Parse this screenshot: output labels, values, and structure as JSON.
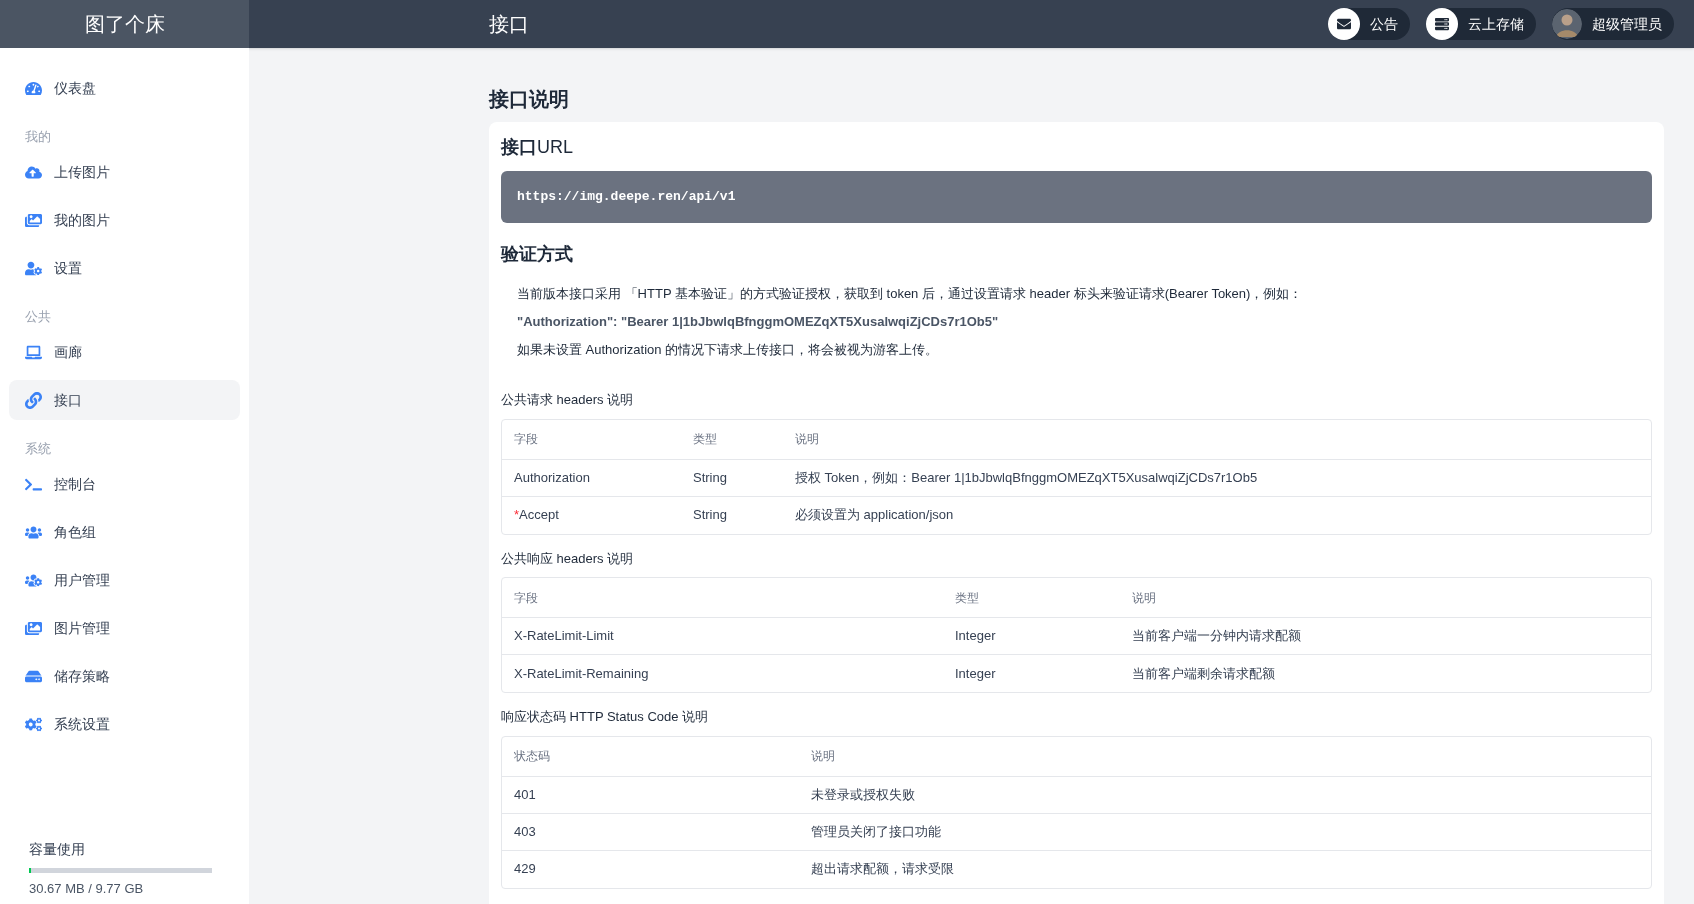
{
  "brand": "图了个床",
  "page_title": "接口",
  "top_actions": [
    {
      "kind": "icon",
      "label": "公告"
    },
    {
      "kind": "icon",
      "label": "云上存储"
    },
    {
      "kind": "avatar",
      "label": "超级管理员"
    }
  ],
  "sidebar": {
    "items": [
      {
        "kind": "item",
        "label": "仪表盘",
        "selected": false
      },
      {
        "kind": "heading",
        "label": "我的"
      },
      {
        "kind": "item",
        "label": "上传图片",
        "selected": false
      },
      {
        "kind": "item",
        "label": "我的图片",
        "selected": false
      },
      {
        "kind": "item",
        "label": "设置",
        "selected": false
      },
      {
        "kind": "heading",
        "label": "公共"
      },
      {
        "kind": "item",
        "label": "画廊",
        "selected": false
      },
      {
        "kind": "item",
        "label": "接口",
        "selected": true
      },
      {
        "kind": "heading",
        "label": "系统"
      },
      {
        "kind": "item",
        "label": "控制台",
        "selected": false
      },
      {
        "kind": "item",
        "label": "角色组",
        "selected": false
      },
      {
        "kind": "item",
        "label": "用户管理",
        "selected": false
      },
      {
        "kind": "item",
        "label": "图片管理",
        "selected": false
      },
      {
        "kind": "item",
        "label": "储存策略",
        "selected": false
      },
      {
        "kind": "item",
        "label": "系统设置",
        "selected": false
      }
    ],
    "storage": {
      "title": "容量使用",
      "level": 0.004,
      "reading": "30.67 MB / 9.77 GB"
    }
  },
  "main": {
    "title": "接口说明",
    "url_heading": "**接口**URL",
    "url": "https://img.deepe.ren/api/v1",
    "auth_heading": "验证方式",
    "auth_lines": [
      {
        "kind": "text",
        "text": "当前版本接口采用 「HTTP 基本验证」的方式验证授权，获取到 token 后，通过设置请求 header 标头来验证请求(Bearer Token)，例如："
      },
      {
        "kind": "code",
        "text": "\"Authorization\": \"Bearer 1|1bJbwlqBfnggmOMEZqXT5XusalwqiZjCDs7r1Ob5\""
      },
      {
        "kind": "text",
        "text": "如果未设置 Authorization 的情况下请求上传接口，将会被视为游客上传。"
      }
    ],
    "tables": [
      {
        "title": "公共请求 headers 说明",
        "kind": "narrow",
        "columns": [
          "字段",
          "类型",
          "说明"
        ],
        "rows": [
          {
            "cells": [
              "Authorization",
              "String",
              "授权 Token，例如：Bearer 1|1bJbwlqBfnggmOMEZqXT5XusalwqiZjCDs7r1Ob5"
            ]
          },
          {
            "required_mark": "*",
            "cells": [
              "Accept",
              "String",
              "必须设置为 application/json"
            ]
          }
        ]
      },
      {
        "title": "公共响应 headers 说明",
        "kind": "wide",
        "columns": [
          "字段",
          "类型",
          "说明"
        ],
        "rows": [
          {
            "cells": [
              "X-RateLimit-Limit",
              "Integer",
              "当前客户端一分钟内请求配额"
            ]
          },
          {
            "cells": [
              "X-RateLimit-Remaining",
              "Integer",
              "当前客户端剩余请求配额"
            ]
          }
        ]
      },
      {
        "title": "响应状态码 HTTP Status Code 说明",
        "kind": "two",
        "columns": [
          "状态码",
          "说明"
        ],
        "rows": [
          {
            "cells": [
              "401",
              "未登录或授权失败"
            ]
          },
          {
            "cells": [
              "403",
              "管理员关闭了接口功能"
            ]
          },
          {
            "cells": [
              "429",
              "超出请求配额，请求受限"
            ]
          }
        ]
      }
    ]
  }
}
